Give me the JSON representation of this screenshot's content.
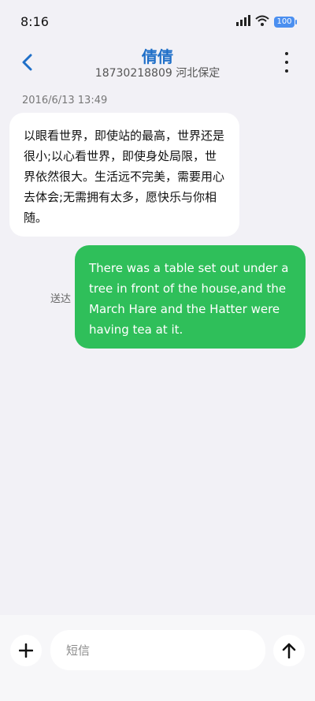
{
  "status_bar": {
    "time": "8:16",
    "battery": "100",
    "icons": [
      "signal-icon",
      "wifi-icon",
      "battery-icon"
    ]
  },
  "header": {
    "contact_name": "倩倩",
    "contact_detail": "18730218809 河北保定",
    "back_icon": "back-chevron-icon",
    "more_icon": "more-vertical-icon"
  },
  "messages": [
    {
      "timestamp": "2016/6/13 13:49",
      "direction": "incoming",
      "text": "以眼看世界，即使站的最高，世界还是很小;以心看世界，即使身处局限，世界依然很大。生活远不完美，需要用心去体会;无需拥有太多，愿快乐与你相随。"
    },
    {
      "direction": "outgoing",
      "status": "送达",
      "text": "There was a table set out under a tree in front of the house,and the March Hare and the Hatter were having tea at it."
    }
  ],
  "composer": {
    "placeholder": "短信",
    "add_icon": "plus-icon",
    "send_icon": "send-up-arrow-icon"
  },
  "colors": {
    "accent": "#1f6fc8",
    "outgoing_bubble": "#2fbf5a",
    "incoming_bubble": "#ffffff",
    "background": "#f2f1f6"
  }
}
